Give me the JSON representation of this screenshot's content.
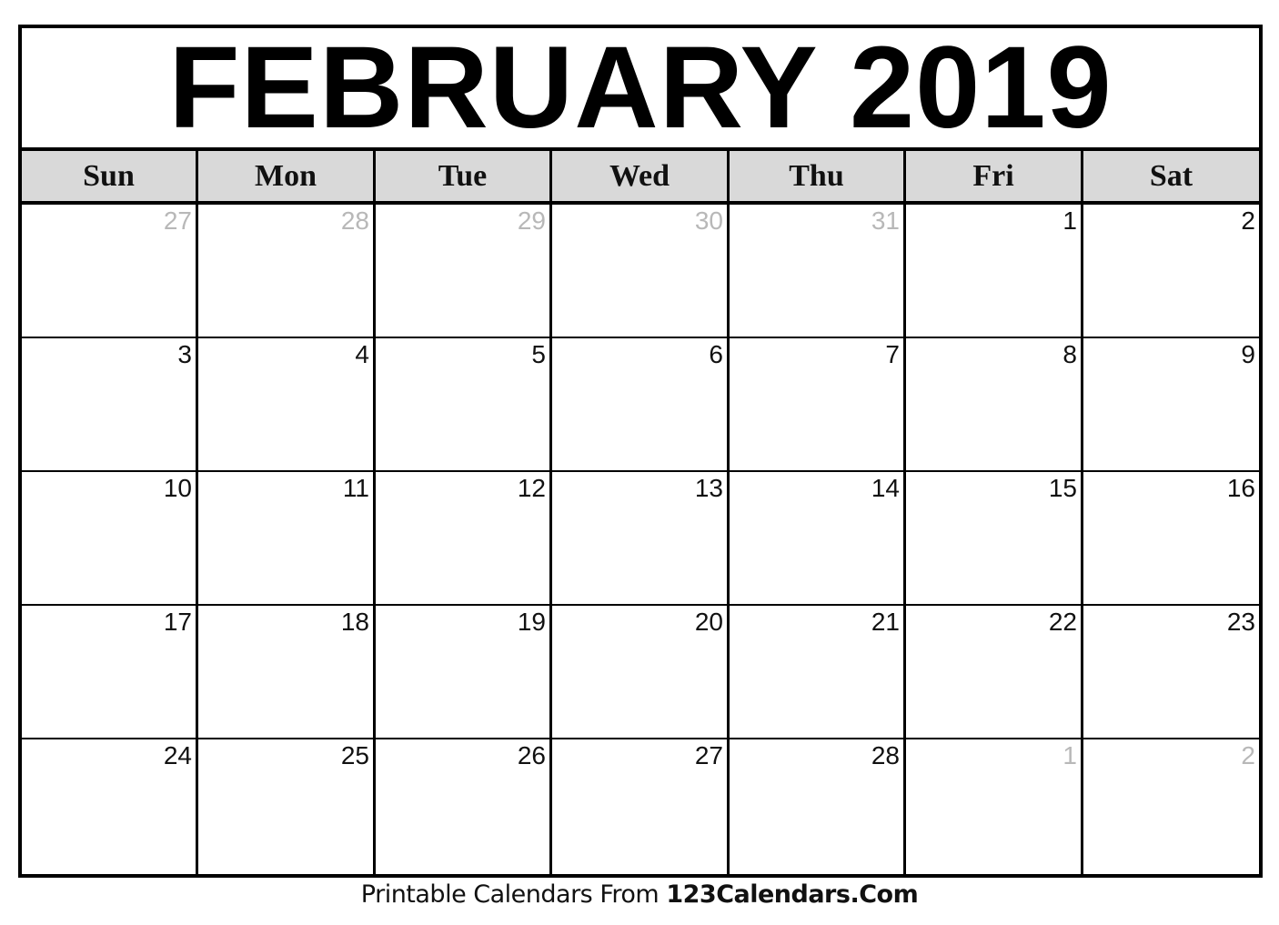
{
  "calendar": {
    "title": "FEBRUARY 2019",
    "month": "FEBRUARY",
    "year": "2019",
    "weekdays": [
      "Sun",
      "Mon",
      "Tue",
      "Wed",
      "Thu",
      "Fri",
      "Sat"
    ],
    "weeks": [
      [
        {
          "day": "27",
          "in_month": false
        },
        {
          "day": "28",
          "in_month": false
        },
        {
          "day": "29",
          "in_month": false
        },
        {
          "day": "30",
          "in_month": false
        },
        {
          "day": "31",
          "in_month": false
        },
        {
          "day": "1",
          "in_month": true
        },
        {
          "day": "2",
          "in_month": true
        }
      ],
      [
        {
          "day": "3",
          "in_month": true
        },
        {
          "day": "4",
          "in_month": true
        },
        {
          "day": "5",
          "in_month": true
        },
        {
          "day": "6",
          "in_month": true
        },
        {
          "day": "7",
          "in_month": true
        },
        {
          "day": "8",
          "in_month": true
        },
        {
          "day": "9",
          "in_month": true
        }
      ],
      [
        {
          "day": "10",
          "in_month": true
        },
        {
          "day": "11",
          "in_month": true
        },
        {
          "day": "12",
          "in_month": true
        },
        {
          "day": "13",
          "in_month": true
        },
        {
          "day": "14",
          "in_month": true
        },
        {
          "day": "15",
          "in_month": true
        },
        {
          "day": "16",
          "in_month": true
        }
      ],
      [
        {
          "day": "17",
          "in_month": true
        },
        {
          "day": "18",
          "in_month": true
        },
        {
          "day": "19",
          "in_month": true
        },
        {
          "day": "20",
          "in_month": true
        },
        {
          "day": "21",
          "in_month": true
        },
        {
          "day": "22",
          "in_month": true
        },
        {
          "day": "23",
          "in_month": true
        }
      ],
      [
        {
          "day": "24",
          "in_month": true
        },
        {
          "day": "25",
          "in_month": true
        },
        {
          "day": "26",
          "in_month": true
        },
        {
          "day": "27",
          "in_month": true
        },
        {
          "day": "28",
          "in_month": true
        },
        {
          "day": "1",
          "in_month": false
        },
        {
          "day": "2",
          "in_month": false
        }
      ]
    ]
  },
  "footer": {
    "prefix": "Printable Calendars From",
    "site": "123Calendars.Com"
  },
  "colors": {
    "header_bg": "#d9d9d9",
    "border": "#000000",
    "in_month_text": "#111111",
    "out_of_month_text": "#b8b8b8"
  }
}
